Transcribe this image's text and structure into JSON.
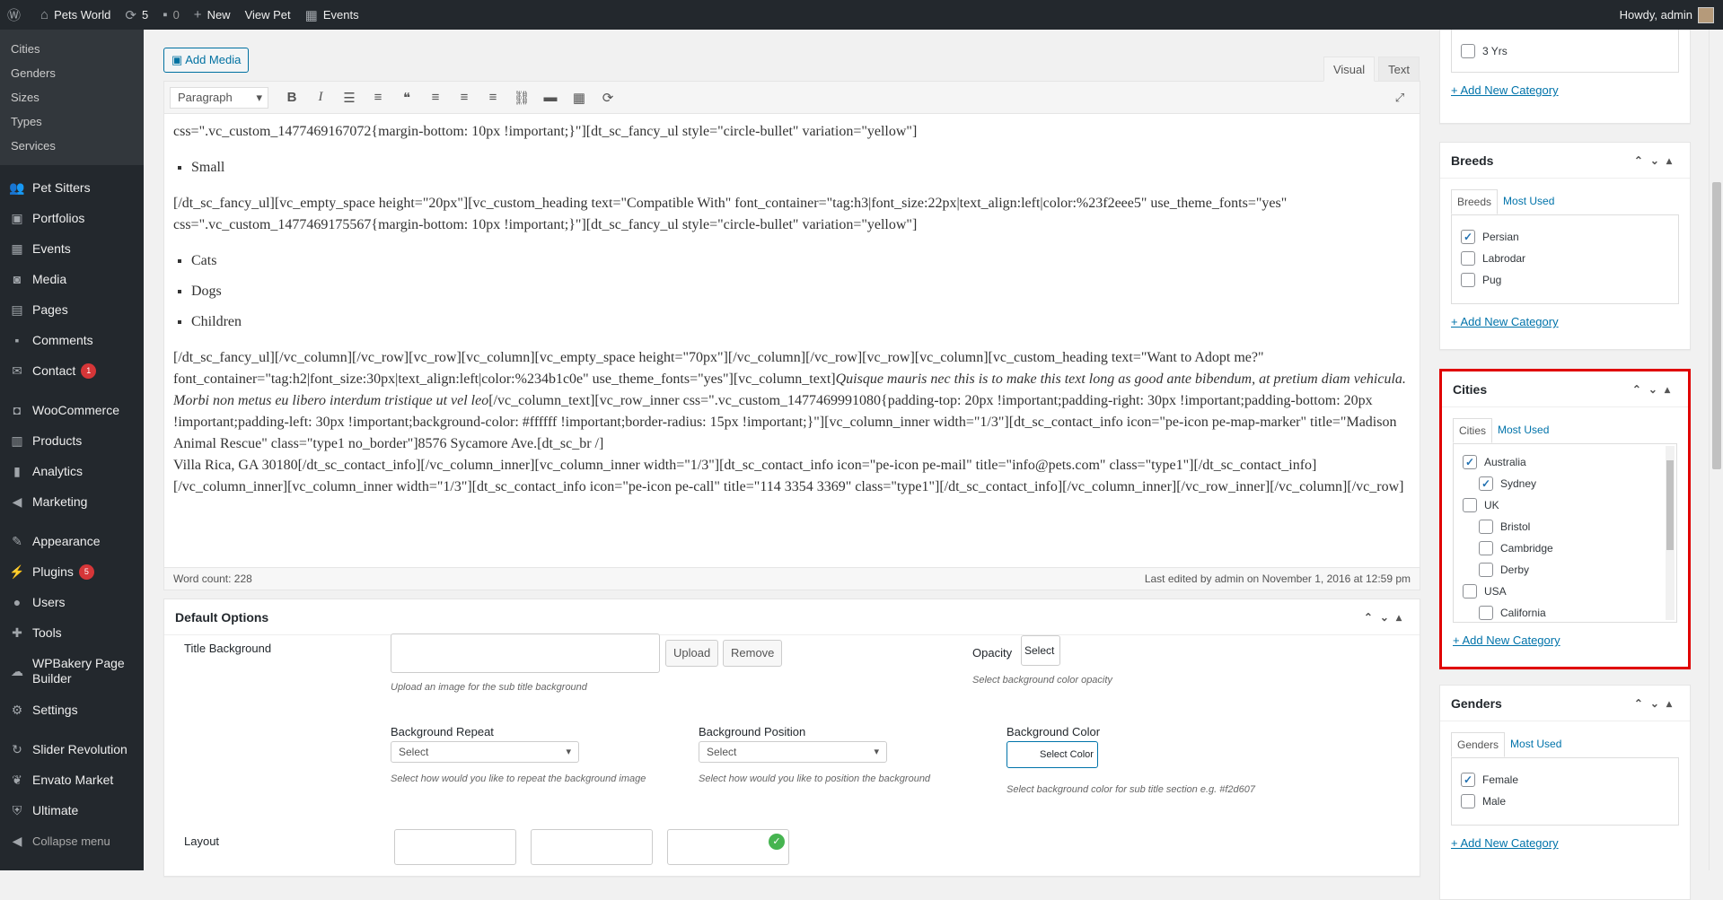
{
  "adminbar": {
    "wp_logo": "wordpress-icon",
    "site_name": "Pets World",
    "updates_count": "5",
    "comments_count": "0",
    "new_label": "New",
    "view_label": "View Pet",
    "events_label": "Events",
    "howdy": "Howdy, admin"
  },
  "sidebar": {
    "submenu": [
      "Cities",
      "Genders",
      "Sizes",
      "Types",
      "Services"
    ],
    "items": [
      {
        "label": "Pet Sitters",
        "icon": "users-icon"
      },
      {
        "label": "Portfolios",
        "icon": "portfolio-icon"
      },
      {
        "label": "Events",
        "icon": "calendar-icon"
      },
      {
        "label": "Media",
        "icon": "media-icon"
      },
      {
        "label": "Pages",
        "icon": "pages-icon"
      },
      {
        "label": "Comments",
        "icon": "comment-icon"
      },
      {
        "label": "Contact",
        "icon": "mail-icon",
        "badge": "1"
      },
      {
        "label": "WooCommerce",
        "icon": "woo-icon"
      },
      {
        "label": "Products",
        "icon": "products-icon"
      },
      {
        "label": "Analytics",
        "icon": "chart-icon"
      },
      {
        "label": "Marketing",
        "icon": "megaphone-icon"
      },
      {
        "label": "Appearance",
        "icon": "brush-icon"
      },
      {
        "label": "Plugins",
        "icon": "plugin-icon",
        "badge": "5"
      },
      {
        "label": "Users",
        "icon": "user-icon"
      },
      {
        "label": "Tools",
        "icon": "wrench-icon"
      },
      {
        "label": "WPBakery Page Builder",
        "icon": "wpbakery-icon"
      },
      {
        "label": "Settings",
        "icon": "settings-icon"
      },
      {
        "label": "Slider Revolution",
        "icon": "slider-icon"
      },
      {
        "label": "Envato Market",
        "icon": "envato-icon"
      },
      {
        "label": "Ultimate",
        "icon": "shield-icon"
      },
      {
        "label": "Collapse menu",
        "icon": "collapse-icon"
      }
    ]
  },
  "editor": {
    "add_media": "Add Media",
    "tab_visual": "Visual",
    "tab_text": "Text",
    "format_select": "Paragraph",
    "p1": "css=\".vc_custom_1477469167072{margin-bottom: 10px !important;}\"][dt_sc_fancy_ul style=\"circle-bullet\" variation=\"yellow\"]",
    "li_small": "Small",
    "p2": "[/dt_sc_fancy_ul][vc_empty_space height=\"20px\"][vc_custom_heading text=\"Compatible With\" font_container=\"tag:h3|font_size:22px|text_align:left|color:%23f2eee5\" use_theme_fonts=\"yes\" css=\".vc_custom_1477469175567{margin-bottom: 10px !important;}\"][dt_sc_fancy_ul style=\"circle-bullet\" variation=\"yellow\"]",
    "li_cats": "Cats",
    "li_dogs": "Dogs",
    "li_children": "Children",
    "p3a": "[/dt_sc_fancy_ul][/vc_column][/vc_row][vc_row][vc_column][vc_empty_space height=\"70px\"][/vc_column][/vc_row][vc_row][vc_column][vc_custom_heading text=\"Want to Adopt me?\" font_container=\"tag:h2|font_size:30px|text_align:left|color:%234b1c0e\" use_theme_fonts=\"yes\"][vc_column_text]",
    "p3_italic": "Quisque mauris nec this is to make this text long as good ante bibendum, at pretium diam vehicula. Morbi non metus eu libero interdum tristique ut vel leo",
    "p3b": "[/vc_column_text][vc_row_inner css=\".vc_custom_1477469991080{padding-top: 20px !important;padding-right: 30px !important;padding-bottom: 20px !important;padding-left: 30px !important;background-color: #ffffff !important;border-radius: 15px !important;}\"][vc_column_inner width=\"1/3\"][dt_sc_contact_info icon=\"pe-icon pe-map-marker\" title=\"Madison Animal Rescue\" class=\"type1 no_border\"]8576 Sycamore Ave.[dt_sc_br /]",
    "p3c": "Villa Rica, GA 30180[/dt_sc_contact_info][/vc_column_inner][vc_column_inner width=\"1/3\"][dt_sc_contact_info icon=\"pe-icon pe-mail\" title=\"info@pets.com\" class=\"type1\"][/dt_sc_contact_info][/vc_column_inner][vc_column_inner width=\"1/3\"][dt_sc_contact_info icon=\"pe-icon pe-call\" title=\"114 3354 3369\" class=\"type1\"][/dt_sc_contact_info][/vc_column_inner][/vc_row_inner][/vc_column][/vc_row]",
    "word_count": "Word count: 228",
    "last_edited": "Last edited by admin on November 1, 2016 at 12:59 pm"
  },
  "default_options": {
    "title": "Default Options",
    "title_bg_label": "Title Background",
    "upload": "Upload",
    "remove": "Remove",
    "upload_hint": "Upload an image for the sub title background",
    "opacity_label": "Opacity",
    "opacity_value": "Select",
    "opacity_hint": "Select background color opacity",
    "bg_repeat_label": "Background Repeat",
    "bg_repeat_value": "Select",
    "bg_repeat_hint": "Select how would you like to repeat the background image",
    "bg_pos_label": "Background Position",
    "bg_pos_value": "Select",
    "bg_pos_hint": "Select how would you like to position the background",
    "bg_color_label": "Background Color",
    "bg_color_btn": "Select Color",
    "bg_color_hint": "Select background color for sub title section e.g. #f2d607",
    "layout_label": "Layout"
  },
  "right": {
    "top": {
      "item": "3 Yrs",
      "add": "+ Add New Category"
    },
    "breeds": {
      "title": "Breeds",
      "tab1": "Breeds",
      "tab2": "Most Used",
      "items": [
        {
          "label": "Persian",
          "checked": true
        },
        {
          "label": "Labrodar",
          "checked": false
        },
        {
          "label": "Pug",
          "checked": false
        }
      ],
      "add": "+ Add New Category"
    },
    "cities": {
      "title": "Cities",
      "tab1": "Cities",
      "tab2": "Most Used",
      "items": [
        {
          "label": "Australia",
          "checked": true,
          "child": false
        },
        {
          "label": "Sydney",
          "checked": true,
          "child": true
        },
        {
          "label": "UK",
          "checked": false,
          "child": false
        },
        {
          "label": "Bristol",
          "checked": false,
          "child": true
        },
        {
          "label": "Cambridge",
          "checked": false,
          "child": true
        },
        {
          "label": "Derby",
          "checked": false,
          "child": true
        },
        {
          "label": "USA",
          "checked": false,
          "child": false
        },
        {
          "label": "California",
          "checked": false,
          "child": true
        }
      ],
      "add": "+ Add New Category",
      "highlight_color": "#e00000"
    },
    "genders": {
      "title": "Genders",
      "tab1": "Genders",
      "tab2": "Most Used",
      "items": [
        {
          "label": "Female",
          "checked": true
        },
        {
          "label": "Male",
          "checked": false
        }
      ],
      "add": "+ Add New Category"
    }
  }
}
